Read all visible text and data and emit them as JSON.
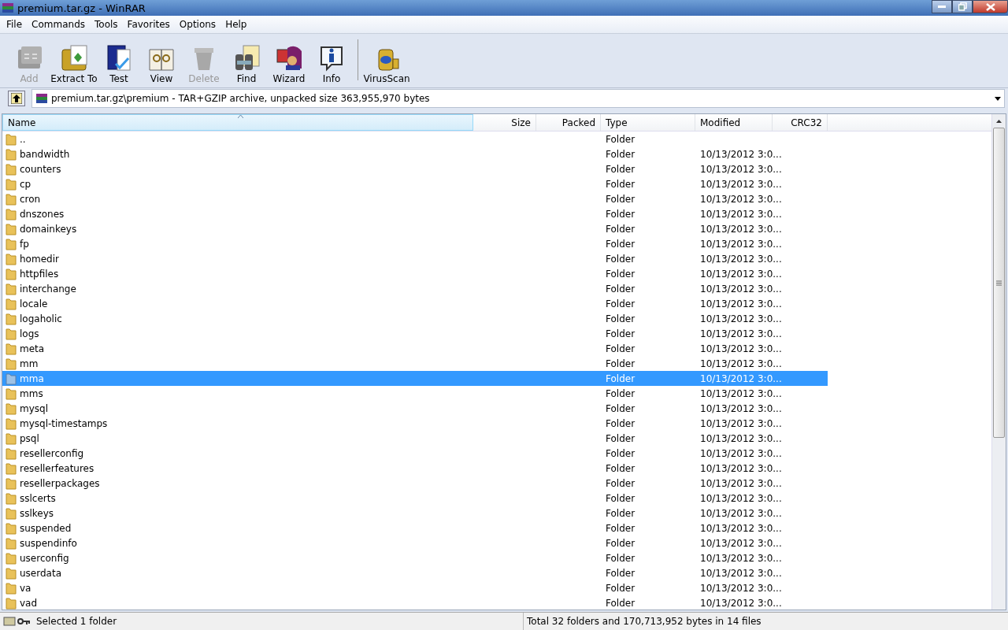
{
  "window": {
    "title": "premium.tar.gz - WinRAR"
  },
  "menu": [
    "File",
    "Commands",
    "Tools",
    "Favorites",
    "Options",
    "Help"
  ],
  "toolbar": [
    {
      "label": "Add",
      "kind": "add",
      "disabled": true
    },
    {
      "label": "Extract To",
      "kind": "extract",
      "disabled": false
    },
    {
      "label": "Test",
      "kind": "test",
      "disabled": false
    },
    {
      "label": "View",
      "kind": "view",
      "disabled": false
    },
    {
      "label": "Delete",
      "kind": "delete",
      "disabled": true
    },
    {
      "label": "Find",
      "kind": "find",
      "disabled": false
    },
    {
      "label": "Wizard",
      "kind": "wizard",
      "disabled": false
    },
    {
      "label": "Info",
      "kind": "info",
      "disabled": false
    },
    {
      "label": "VirusScan",
      "kind": "scan",
      "disabled": false
    }
  ],
  "address": {
    "path": "premium.tar.gz\\premium - TAR+GZIP archive, unpacked size 363,955,970 bytes"
  },
  "table": {
    "columns": [
      {
        "label": "Name",
        "sorted": true
      },
      {
        "label": "Size",
        "sorted": false
      },
      {
        "label": "Packed",
        "sorted": false
      },
      {
        "label": "Type",
        "sorted": false
      },
      {
        "label": "Modified",
        "sorted": false
      },
      {
        "label": "CRC32",
        "sorted": false
      }
    ],
    "rows": [
      {
        "name": "..",
        "type": "Folder",
        "selected": false
      },
      {
        "name": "bandwidth",
        "type": "Folder",
        "modified": "10/13/2012 3:0...",
        "selected": false
      },
      {
        "name": "counters",
        "type": "Folder",
        "modified": "10/13/2012 3:0...",
        "selected": false
      },
      {
        "name": "cp",
        "type": "Folder",
        "modified": "10/13/2012 3:0...",
        "selected": false
      },
      {
        "name": "cron",
        "type": "Folder",
        "modified": "10/13/2012 3:0...",
        "selected": false
      },
      {
        "name": "dnszones",
        "type": "Folder",
        "modified": "10/13/2012 3:0...",
        "selected": false
      },
      {
        "name": "domainkeys",
        "type": "Folder",
        "modified": "10/13/2012 3:0...",
        "selected": false
      },
      {
        "name": "fp",
        "type": "Folder",
        "modified": "10/13/2012 3:0...",
        "selected": false
      },
      {
        "name": "homedir",
        "type": "Folder",
        "modified": "10/13/2012 3:0...",
        "selected": false
      },
      {
        "name": "httpfiles",
        "type": "Folder",
        "modified": "10/13/2012 3:0...",
        "selected": false
      },
      {
        "name": "interchange",
        "type": "Folder",
        "modified": "10/13/2012 3:0...",
        "selected": false
      },
      {
        "name": "locale",
        "type": "Folder",
        "modified": "10/13/2012 3:0...",
        "selected": false
      },
      {
        "name": "logaholic",
        "type": "Folder",
        "modified": "10/13/2012 3:0...",
        "selected": false
      },
      {
        "name": "logs",
        "type": "Folder",
        "modified": "10/13/2012 3:0...",
        "selected": false
      },
      {
        "name": "meta",
        "type": "Folder",
        "modified": "10/13/2012 3:0...",
        "selected": false
      },
      {
        "name": "mm",
        "type": "Folder",
        "modified": "10/13/2012 3:0...",
        "selected": false
      },
      {
        "name": "mma",
        "type": "Folder",
        "modified": "10/13/2012 3:0...",
        "selected": true
      },
      {
        "name": "mms",
        "type": "Folder",
        "modified": "10/13/2012 3:0...",
        "selected": false
      },
      {
        "name": "mysql",
        "type": "Folder",
        "modified": "10/13/2012 3:0...",
        "selected": false
      },
      {
        "name": "mysql-timestamps",
        "type": "Folder",
        "modified": "10/13/2012 3:0...",
        "selected": false
      },
      {
        "name": "psql",
        "type": "Folder",
        "modified": "10/13/2012 3:0...",
        "selected": false
      },
      {
        "name": "resellerconfig",
        "type": "Folder",
        "modified": "10/13/2012 3:0...",
        "selected": false
      },
      {
        "name": "resellerfeatures",
        "type": "Folder",
        "modified": "10/13/2012 3:0...",
        "selected": false
      },
      {
        "name": "resellerpackages",
        "type": "Folder",
        "modified": "10/13/2012 3:0...",
        "selected": false
      },
      {
        "name": "sslcerts",
        "type": "Folder",
        "modified": "10/13/2012 3:0...",
        "selected": false
      },
      {
        "name": "sslkeys",
        "type": "Folder",
        "modified": "10/13/2012 3:0...",
        "selected": false
      },
      {
        "name": "suspended",
        "type": "Folder",
        "modified": "10/13/2012 3:0...",
        "selected": false
      },
      {
        "name": "suspendinfo",
        "type": "Folder",
        "modified": "10/13/2012 3:0...",
        "selected": false
      },
      {
        "name": "userconfig",
        "type": "Folder",
        "modified": "10/13/2012 3:0...",
        "selected": false
      },
      {
        "name": "userdata",
        "type": "Folder",
        "modified": "10/13/2012 3:0...",
        "selected": false
      },
      {
        "name": "va",
        "type": "Folder",
        "modified": "10/13/2012 3:0...",
        "selected": false
      },
      {
        "name": "vad",
        "type": "Folder",
        "modified": "10/13/2012 3:0...",
        "selected": false
      }
    ]
  },
  "status_bar": {
    "left": "Selected 1 folder",
    "right": "Total 32 folders and 170,713,952 bytes in 14 files"
  }
}
